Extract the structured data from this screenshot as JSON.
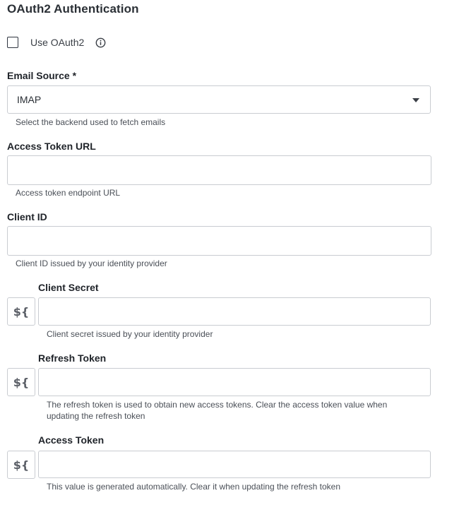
{
  "section": {
    "title": "OAuth2 Authentication"
  },
  "use_oauth2": {
    "label": "Use OAuth2",
    "checked": false,
    "info_icon": "info-circle-icon"
  },
  "email_source": {
    "label": "Email Source *",
    "value": "IMAP",
    "help": "Select the backend used to fetch emails"
  },
  "access_token_url": {
    "label": "Access Token URL",
    "value": "",
    "help": "Access token endpoint URL"
  },
  "client_id": {
    "label": "Client ID",
    "value": "",
    "help": "Client ID issued by your identity provider"
  },
  "client_secret": {
    "label": "Client Secret",
    "var_button": "${",
    "value": "",
    "help": "Client secret issued by your identity provider"
  },
  "refresh_token": {
    "label": "Refresh Token",
    "var_button": "${",
    "value": "",
    "help_line1": "The refresh token is used to obtain new access tokens. Clear the access token value when",
    "help_line2": "updating the refresh token"
  },
  "access_token": {
    "label": "Access Token",
    "var_button": "${",
    "value": "",
    "help": "This value is generated automatically. Clear it when updating the refresh token"
  }
}
